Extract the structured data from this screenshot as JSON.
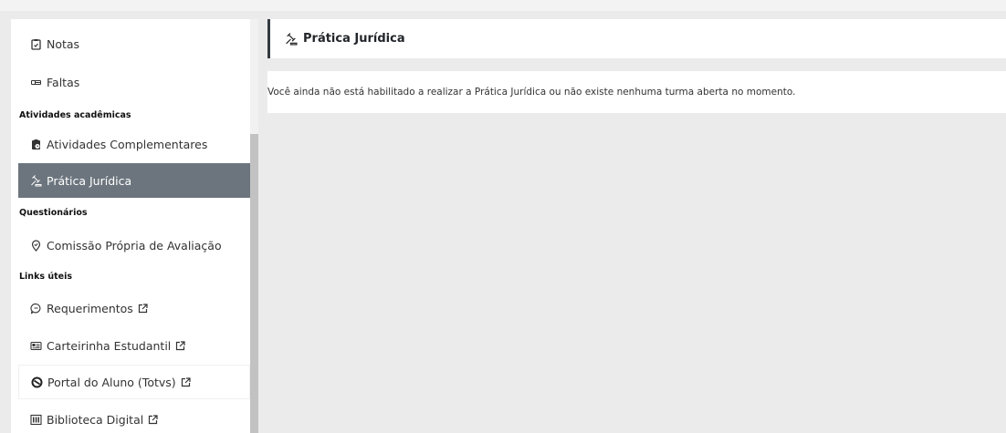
{
  "sidebar": {
    "items": [
      {
        "label": "Notas",
        "icon": "clipboard-check-icon"
      },
      {
        "label": "Faltas",
        "icon": "id-list-icon"
      },
      {
        "label": "Atividades Complementares",
        "icon": "clipboard-clock-icon"
      },
      {
        "label": "Prática Jurídica",
        "icon": "gavel-icon",
        "active": true
      },
      {
        "label": "Comissão Própria de Avaliação",
        "icon": "location-pin-icon"
      },
      {
        "label": "Requerimentos",
        "icon": "chat-bubble-icon",
        "external": true
      },
      {
        "label": "Carteirinha Estudantil",
        "icon": "id-card-icon",
        "external": true
      },
      {
        "label": "Portal do Aluno (Totvs)",
        "icon": "circle-slash-icon",
        "external": true
      },
      {
        "label": "Biblioteca Digital",
        "icon": "building-columns-icon",
        "external": true
      }
    ],
    "sections": {
      "academic": "Atividades acadêmicas",
      "surveys": "Questionários",
      "links": "Links úteis"
    }
  },
  "main": {
    "header_title": "Prática Jurídica",
    "header_icon": "gavel-icon",
    "message": "Você ainda não está habilitado a realizar a Prática Jurídica ou não existe nenhuma turma aberta no momento."
  },
  "colors": {
    "active_bg": "#6c757d",
    "header_border": "#343a40",
    "page_bg": "#ebebeb"
  }
}
